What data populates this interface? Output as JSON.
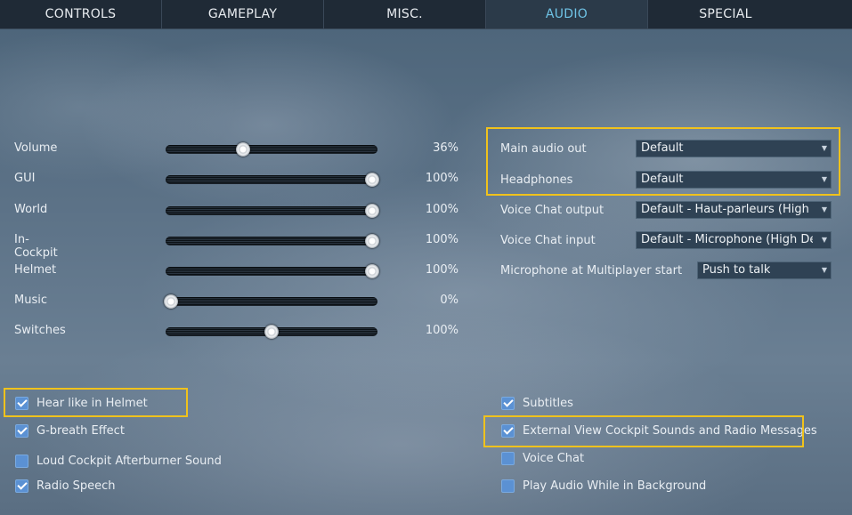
{
  "tabs": [
    {
      "label": "CONTROLS",
      "active": false
    },
    {
      "label": "GAMEPLAY",
      "active": false
    },
    {
      "label": "MISC.",
      "active": false
    },
    {
      "label": "AUDIO",
      "active": true
    },
    {
      "label": "SPECIAL",
      "active": false
    }
  ],
  "sliders": [
    {
      "label": "Volume",
      "value": 36,
      "display": "36%"
    },
    {
      "label": "GUI",
      "value": 100,
      "display": "100%"
    },
    {
      "label": "World",
      "value": 100,
      "display": "100%"
    },
    {
      "label": "In-Cockpit",
      "value": 100,
      "display": "100%"
    },
    {
      "label": "Helmet",
      "value": 100,
      "display": "100%"
    },
    {
      "label": "Music",
      "value": 0,
      "display": "0%"
    },
    {
      "label": "Switches",
      "value": 50,
      "display": "100%"
    }
  ],
  "dropdowns": [
    {
      "label": "Main audio out",
      "value": "Default"
    },
    {
      "label": "Headphones",
      "value": "Default"
    },
    {
      "label": "Voice Chat output",
      "value": "Default - Haut-parleurs (High Definition Audio)"
    },
    {
      "label": "Voice Chat input",
      "value": "Default - Microphone (High Definition Audio)"
    },
    {
      "label": "Microphone at Multiplayer start",
      "value": "Push to talk"
    }
  ],
  "checkboxes_left": [
    {
      "label": "Hear like in Helmet",
      "checked": true
    },
    {
      "label": "G-breath Effect",
      "checked": true
    },
    {
      "label": "Loud Cockpit Afterburner Sound",
      "checked": false
    },
    {
      "label": "Radio Speech",
      "checked": true
    }
  ],
  "checkboxes_right": [
    {
      "label": "Subtitles",
      "checked": true
    },
    {
      "label": "External View Cockpit Sounds and Radio Messages",
      "checked": true
    },
    {
      "label": "Voice Chat",
      "checked": false
    },
    {
      "label": "Play Audio While in Background",
      "checked": false
    }
  ],
  "colors": {
    "accent_tab": "#6fc3e6",
    "highlight": "#f0c21c",
    "checkbox": "#5b91d3"
  }
}
